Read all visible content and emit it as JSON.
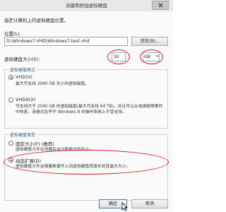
{
  "window": {
    "title": "创建和附加虚拟硬盘"
  },
  "intro": "指定计算机上的虚拟硬盘位置。",
  "location": {
    "label": "位置(L):",
    "value": "D:\\Windows7-VHD\\Windows7-test.vhd",
    "browse_label": "浏览(B)..."
  },
  "size": {
    "label": "虚拟硬盘大小(S):",
    "value": "50",
    "unit": "GB"
  },
  "format": {
    "group_label": "虚拟硬盘格式",
    "options": [
      {
        "label": "VHD(V)",
        "desc": "最大可支持 2040 GB 大小的虚拟磁盘。",
        "selected": true
      },
      {
        "label": "VHDX(X)",
        "desc": "可支持大于 2040 GB 的虚拟磁盘(最大可支持 64 TB)，并且可以从电源故障事件中恢复。该格式在早于 Windows 8 的操作系统上不受支持。",
        "desc_tail": "Windows 8.",
        "selected": false
      }
    ]
  },
  "type": {
    "group_label": "虚拟硬盘类型",
    "options": [
      {
        "label": "固定大小(F) (推荐)",
        "desc": "虚拟硬盘文件在创建后会分配最大的大小。",
        "selected": false
      },
      {
        "label": "动态扩展(D)",
        "desc": "虚拟硬盘文件会随着数据写入到虚拟硬盘而增长到其最大大小。",
        "selected": true
      }
    ]
  },
  "buttons": {
    "ok": "确定",
    "cancel": "取消"
  },
  "colors": {
    "annotation_red": "#d8181f",
    "ok_border": "#3c7fb1"
  }
}
